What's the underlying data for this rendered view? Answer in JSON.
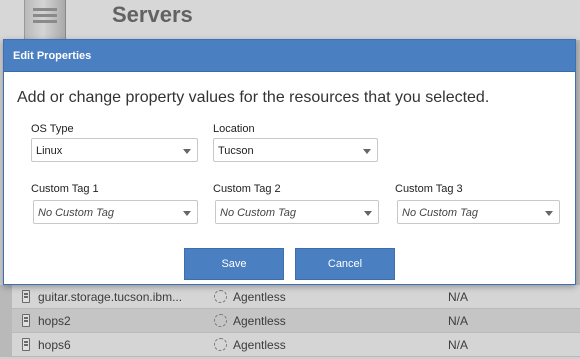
{
  "page": {
    "title": "Servers"
  },
  "dialog": {
    "title": "Edit Properties",
    "instructions": "Add or change property values for the resources that you selected.",
    "fields": {
      "os_type": {
        "label": "OS Type",
        "value": "Linux"
      },
      "location": {
        "label": "Location",
        "value": "Tucson"
      },
      "custom_tag_1": {
        "label": "Custom Tag 1",
        "placeholder": "No Custom Tag"
      },
      "custom_tag_2": {
        "label": "Custom Tag 2",
        "placeholder": "No Custom Tag"
      },
      "custom_tag_3": {
        "label": "Custom Tag 3",
        "placeholder": "No Custom Tag"
      }
    },
    "save_label": "Save",
    "cancel_label": "Cancel"
  },
  "table": {
    "rows": [
      {
        "name": "guitar.storage.tucson.ibm...",
        "agent": "Agentless",
        "status": "N/A"
      },
      {
        "name": "hops2",
        "agent": "Agentless",
        "status": "N/A"
      },
      {
        "name": "hops6",
        "agent": "Agentless",
        "status": "N/A"
      }
    ]
  },
  "icons": {
    "server": "server-icon",
    "device": "storage-device-icon",
    "agent": "agentless-icon",
    "dropdown": "chevron-down-icon"
  },
  "colors": {
    "accent": "#4a7fc1"
  }
}
